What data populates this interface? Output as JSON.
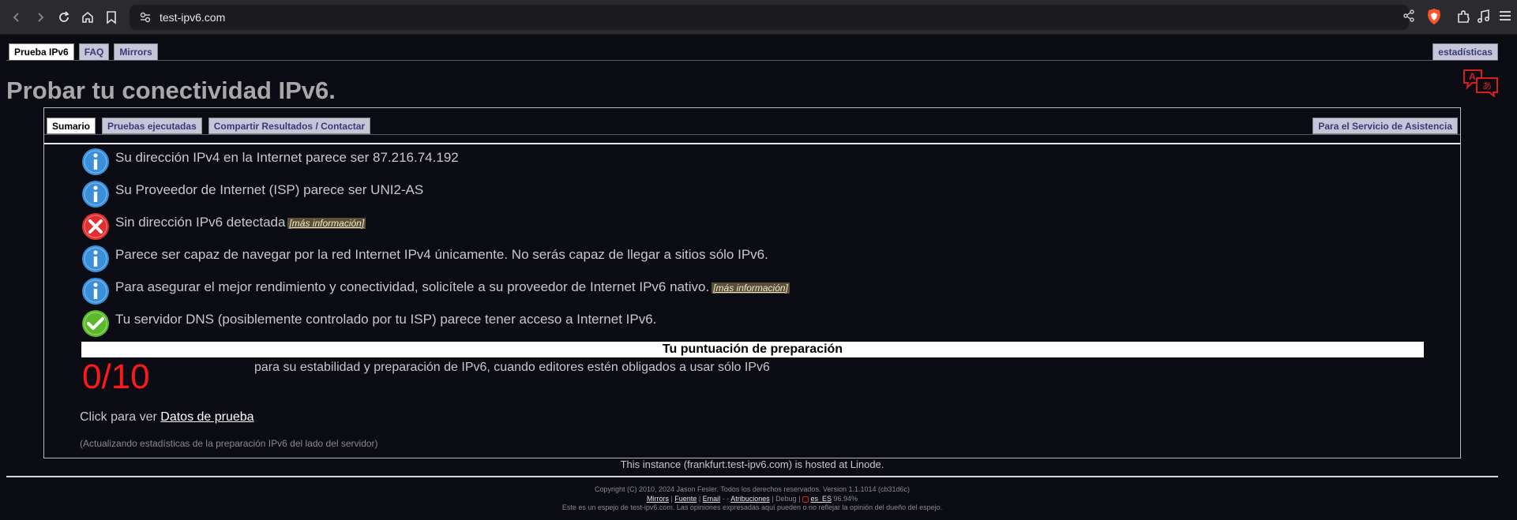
{
  "browser": {
    "url": "test-ipv6.com"
  },
  "top_tabs": {
    "test": "Prueba IPv6",
    "faq": "FAQ",
    "mirrors": "Mirrors",
    "stats": "estadísticas"
  },
  "page_title": "Probar tu conectividad IPv6.",
  "inner_tabs": {
    "summary": "Sumario",
    "tests": "Pruebas ejecutadas",
    "share": "Compartir Resultados / Contactar",
    "helpdesk": "Para el Servicio de Asistencia"
  },
  "results": [
    {
      "status": "info",
      "text": "Su dirección IPv4 en la Internet parece ser 87.216.74.192",
      "more": ""
    },
    {
      "status": "info",
      "text": "Su Proveedor de Internet (ISP) parece ser UNI2-AS",
      "more": ""
    },
    {
      "status": "error",
      "text": "Sin dirección IPv6 detectada",
      "more": "[más información]"
    },
    {
      "status": "info",
      "text": "Parece ser capaz de navegar por la red Internet IPv4 únicamente. No serás capaz de llegar a sitios sólo IPv6.",
      "more": ""
    },
    {
      "status": "info",
      "text": "Para asegurar el mejor rendimiento y conectividad, solicítele a su proveedor de Internet IPv6 nativo.",
      "more": "[más información]"
    },
    {
      "status": "ok",
      "text": "Tu servidor DNS (posiblemente controlado por tu ISP) parece tener acceso a Internet IPv6.",
      "more": ""
    }
  ],
  "score": {
    "header": "Tu puntuación de preparación",
    "value": "0/10",
    "description": "para su estabilidad y preparación de IPv6, cuando editores estén obligados a usar sólo IPv6"
  },
  "click_prefix": "Click para ver",
  "click_link": "Datos de prueba",
  "updating": "(Actualizando estadísticas de la preparación IPv6 del lado del servidor)",
  "hosted": "This instance (frankfurt.test-ipv6.com) is hosted at Linode.",
  "footer": {
    "copyright": "Copyright (C) 2010, 2024 Jason Fesler. Todos los derechos reservados. Version 1.1.1014 (cb31d6c)",
    "links": {
      "mirrors": "Mirrors",
      "source": "Fuente",
      "email": "Email",
      "attributions": "Atribuciones",
      "debug": "Debug",
      "locale": "es_ES",
      "percent": "96.94%"
    },
    "mirror_note": "Este es un espejo de test-ipv6.com. Las opiniones expresadas aquí pueden o no reflejar la opinión del dueño del espejo."
  },
  "colors": {
    "info": "#3b8fd9",
    "error": "#e03030",
    "ok": "#5cb82c",
    "score": "#ff1a1a"
  }
}
